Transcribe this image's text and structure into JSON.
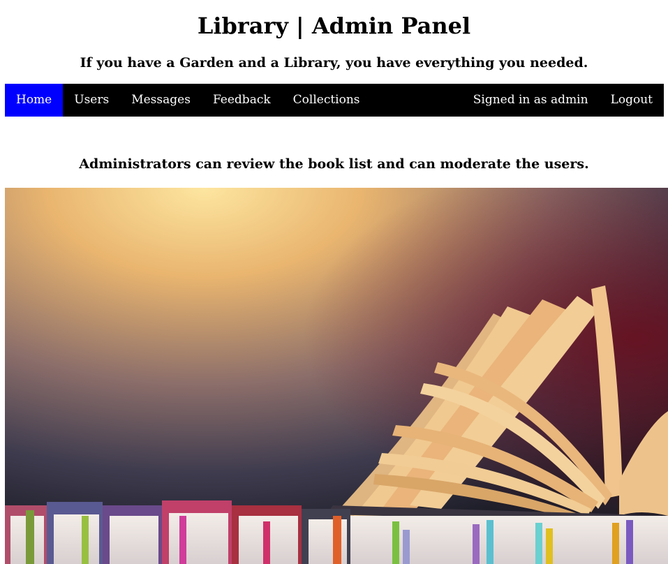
{
  "header": {
    "title": "Library | Admin Panel",
    "tagline": "If you have a Garden and a Library, you have everything you needed."
  },
  "nav": {
    "items": [
      {
        "label": "Home",
        "active": true
      },
      {
        "label": "Users",
        "active": false
      },
      {
        "label": "Messages",
        "active": false
      },
      {
        "label": "Feedback",
        "active": false
      },
      {
        "label": "Collections",
        "active": false
      }
    ],
    "signed_in": "Signed in as admin",
    "logout": "Logout",
    "active_color": "#0000ff",
    "bar_color": "#000000"
  },
  "main": {
    "intro": "Administrators can review the book list and can moderate the users."
  }
}
